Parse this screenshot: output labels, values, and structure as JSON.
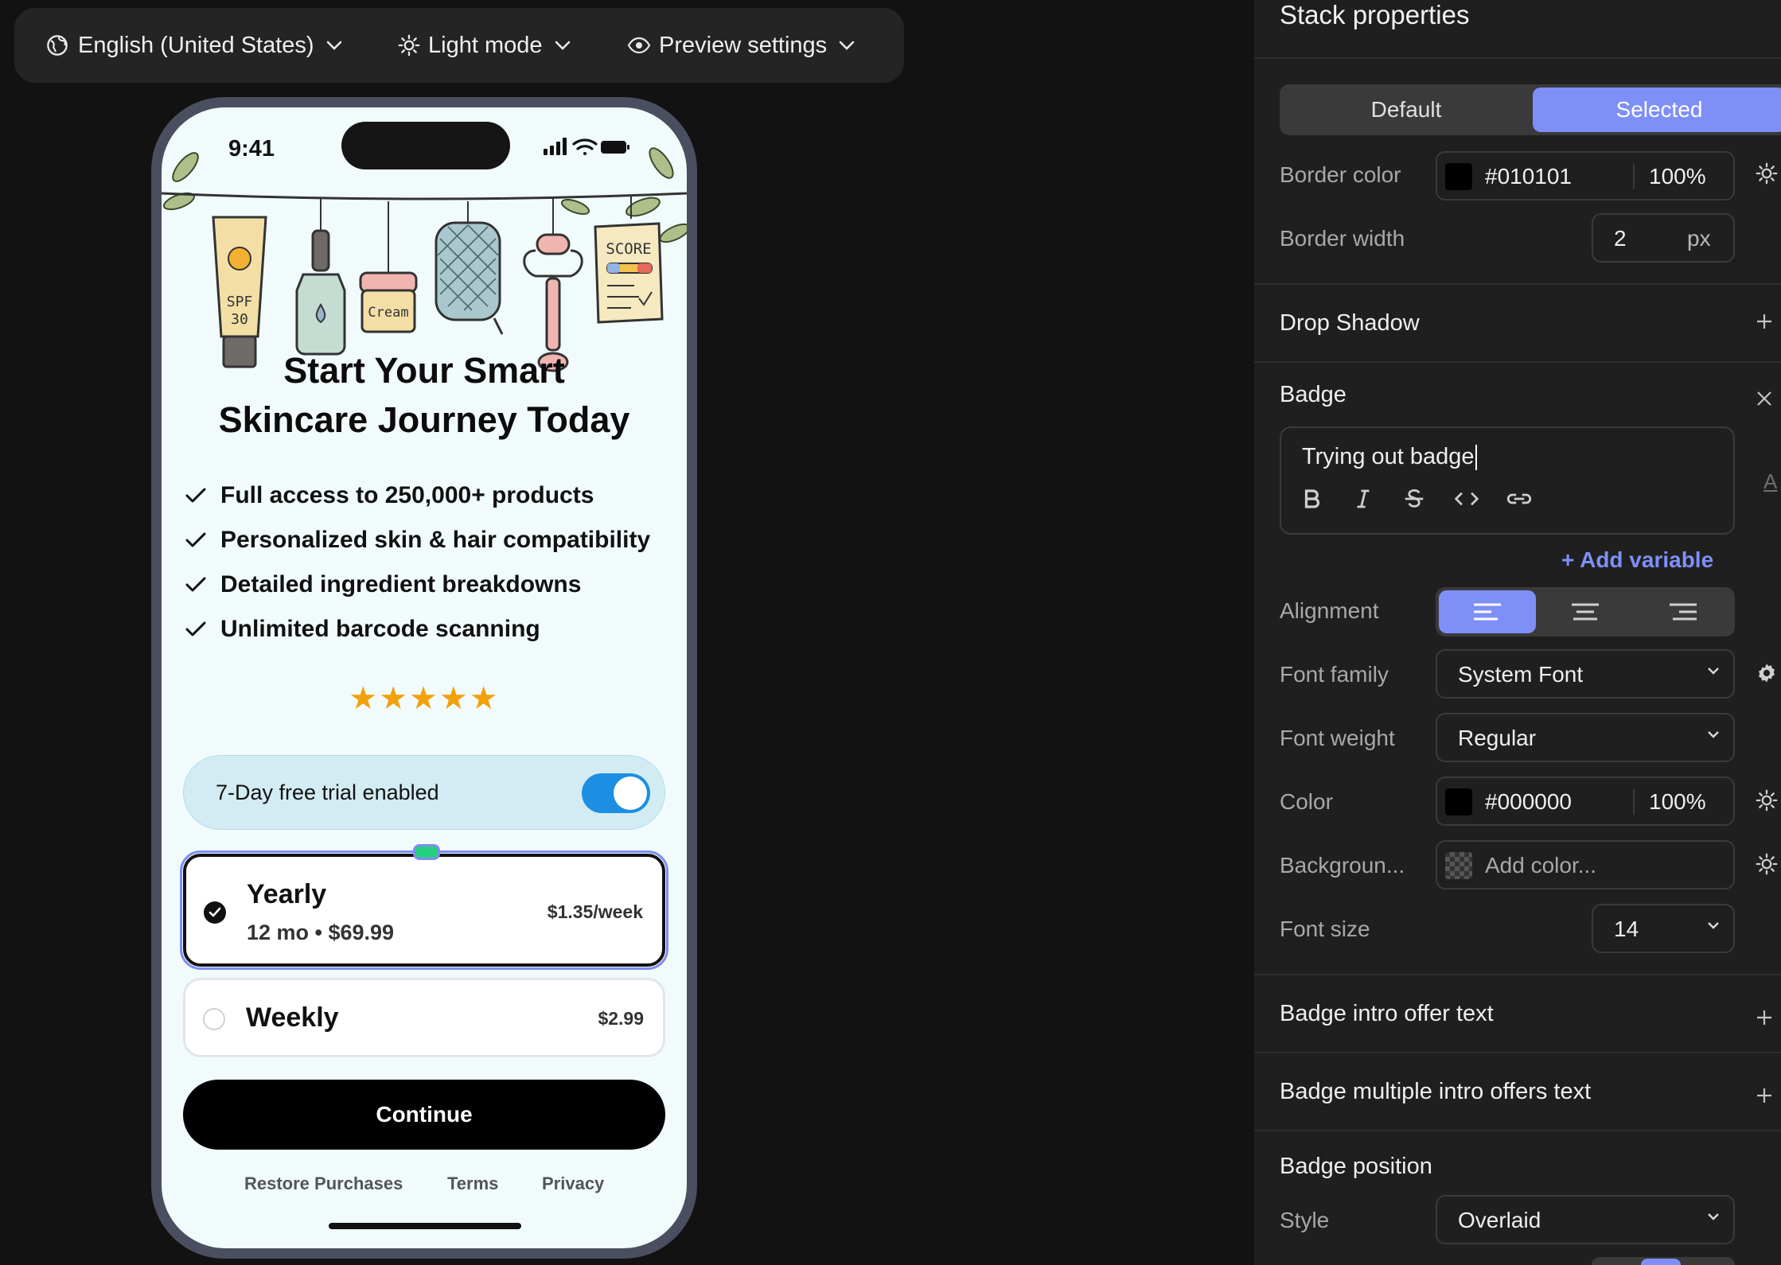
{
  "toolbar": {
    "language": "English (United States)",
    "theme": "Light mode",
    "preview": "Preview settings"
  },
  "phone": {
    "status_time": "9:41",
    "illustration_texts": [
      "SPF",
      "30",
      "Cream",
      "SCORE"
    ],
    "title_line1": "Start Your Smart",
    "title_line2": "Skincare Journey Today",
    "features": [
      "Full access to 250,000+ products",
      "Personalized skin & hair compatibility",
      "Detailed ingredient breakdowns",
      "Unlimited barcode scanning"
    ],
    "rating_stars": 5,
    "trial": {
      "label": "7-Day free trial enabled",
      "enabled": true
    },
    "plans": [
      {
        "title": "Yearly",
        "subtitle": "12 mo • $69.99",
        "price": "$1.35/week",
        "selected": true
      },
      {
        "title": "Weekly",
        "subtitle": "",
        "price": "$2.99",
        "selected": false
      }
    ],
    "cta": "Continue",
    "footer": {
      "restore": "Restore Purchases",
      "terms": "Terms",
      "privacy": "Privacy"
    }
  },
  "panel": {
    "title": "Stack properties",
    "state_tabs": {
      "default": "Default",
      "selected": "Selected",
      "active": "Selected"
    },
    "border_color": {
      "label": "Border color",
      "hex": "#010101",
      "opacity": "100%"
    },
    "border_width": {
      "label": "Border width",
      "value": "2",
      "unit": "px"
    },
    "drop_shadow": "Drop Shadow",
    "badge": {
      "header": "Badge",
      "text": "Trying out badge",
      "add_variable": "+ Add variable",
      "alignment_label": "Alignment",
      "alignment": "left",
      "font_family": {
        "label": "Font family",
        "value": "System Font"
      },
      "font_weight": {
        "label": "Font weight",
        "value": "Regular"
      },
      "color": {
        "label": "Color",
        "hex": "#000000",
        "opacity": "100%"
      },
      "background": {
        "label": "Backgroun...",
        "placeholder": "Add color..."
      },
      "font_size": {
        "label": "Font size",
        "value": "14"
      }
    },
    "badge_intro_offer": "Badge intro offer text",
    "badge_multi_intro": "Badge multiple intro offers text",
    "badge_position": {
      "header": "Badge position",
      "style_label": "Style",
      "style_value": "Overlaid"
    }
  },
  "colors": {
    "accent": "#7f8ff8",
    "toggle": "#1d8fe2",
    "star": "#f2a10c",
    "handle": "#27d07e"
  }
}
